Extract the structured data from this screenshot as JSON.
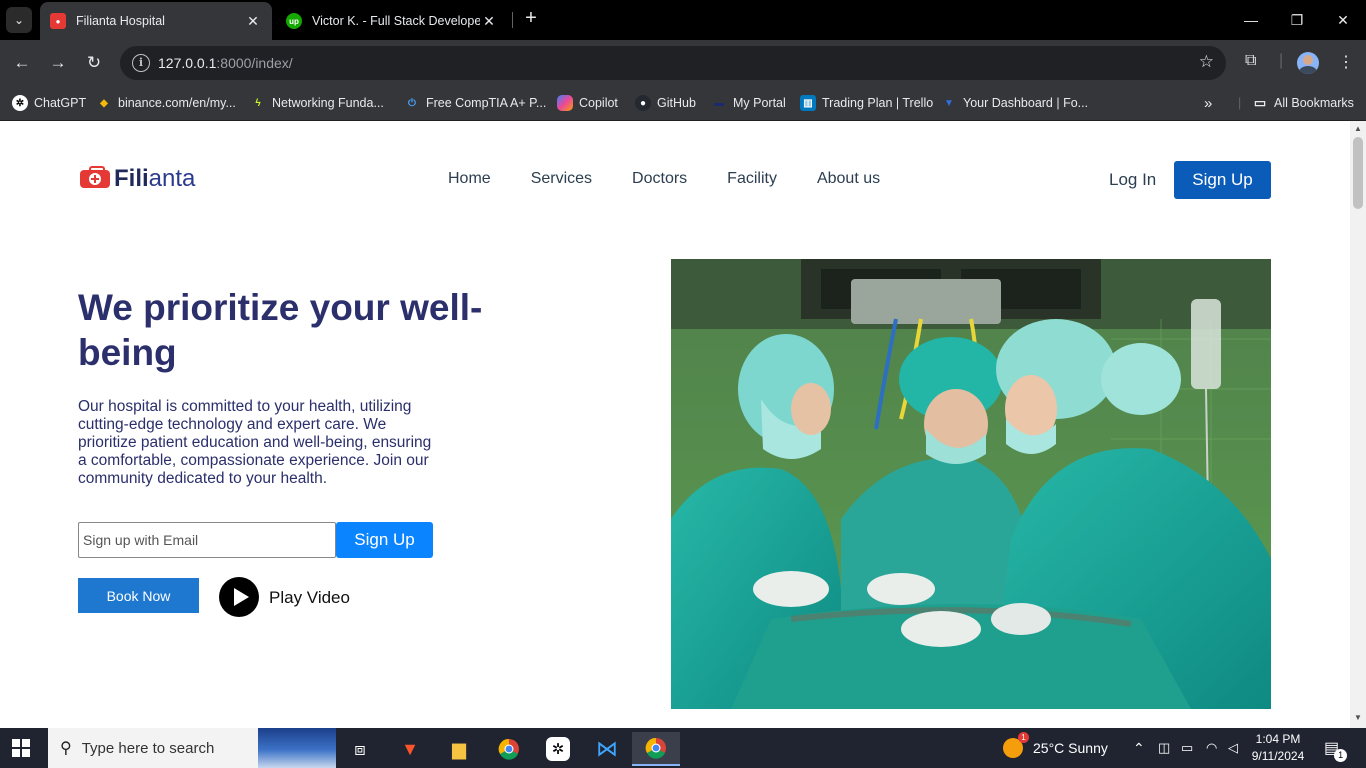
{
  "browser": {
    "tabs": [
      {
        "title": "Filianta Hospital",
        "active": true,
        "favicon": "red-square-icon"
      },
      {
        "title": "Victor K. - Full Stack Developer",
        "active": false,
        "favicon": "upwork-icon"
      }
    ],
    "url_host": "127.0.0.1",
    "url_path": ":8000/index/",
    "bookmarks": [
      {
        "label": "ChatGPT",
        "icon": "chatgpt-icon"
      },
      {
        "label": "binance.com/en/my...",
        "icon": "binance-icon"
      },
      {
        "label": "Networking Funda...",
        "icon": "bolt-icon"
      },
      {
        "label": "Free CompTIA A+ P...",
        "icon": "power-icon"
      },
      {
        "label": "Copilot",
        "icon": "copilot-icon"
      },
      {
        "label": "GitHub",
        "icon": "github-icon"
      },
      {
        "label": "My Portal",
        "icon": "portal-icon"
      },
      {
        "label": "Trading Plan | Trello",
        "icon": "trello-icon"
      },
      {
        "label": "Your Dashboard | Fo...",
        "icon": "dashboard-icon"
      }
    ],
    "all_bookmarks_label": "All Bookmarks",
    "overflow_label": "»"
  },
  "site": {
    "logo_part_a": "Fili",
    "logo_part_b": "anta",
    "nav": [
      "Home",
      "Services",
      "Doctors",
      "Facility",
      "About us"
    ],
    "login_label": "Log In",
    "signup_label": "Sign Up",
    "hero_title": "We prioritize your well-being",
    "hero_description": "Our hospital is committed to your health, utilizing cutting-edge technology and expert care. We prioritize patient education and well-being, ensuring a comfortable, compassionate experience. Join our community dedicated to your health.",
    "email_placeholder": "Sign up with Email",
    "email_signup_label": "Sign Up",
    "book_now_label": "Book Now",
    "play_video_label": "Play Video",
    "hero_image": "surgeons-operating-room-photo"
  },
  "taskbar": {
    "search_placeholder": "Type here to search",
    "weather": "25°C  Sunny",
    "weather_badge": "1",
    "time": "1:04 PM",
    "date": "9/11/2024",
    "notification_count": "1"
  },
  "colors": {
    "brand_navy": "#2b2f6b",
    "signup_blue": "#0b5cb8",
    "email_signup_blue": "#0a84ff",
    "book_now_blue": "#1e78cf",
    "logo_red": "#e53935"
  }
}
